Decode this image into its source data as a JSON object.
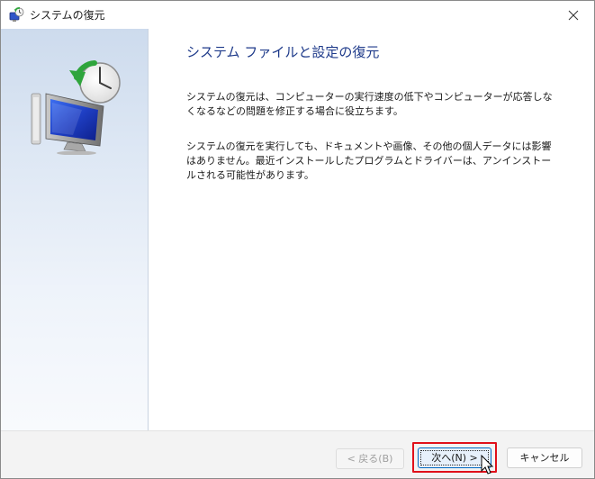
{
  "window": {
    "title": "システムの復元",
    "close_icon": "close-icon",
    "app_icon": "system-restore-icon"
  },
  "left_pane": {
    "illustration": "system-restore-illustration"
  },
  "content": {
    "heading": "システム ファイルと設定の復元",
    "paragraph1": "システムの復元は、コンピューターの実行速度の低下やコンピューターが応答しなくなるなどの問題を修正する場合に役立ちます。",
    "paragraph2": "システムの復元を実行しても、ドキュメントや画像、その他の個人データには影響はありません。最近インストールしたプログラムとドライバーは、アンインストールされる可能性があります。"
  },
  "footer": {
    "back_label": "< 戻る(B)",
    "back_enabled": false,
    "next_label": "次へ(N) >",
    "next_highlight_color": "#e0101a",
    "cancel_label": "キャンセル"
  },
  "colors": {
    "heading": "#1e3a8a",
    "accent": "#0067c0"
  }
}
